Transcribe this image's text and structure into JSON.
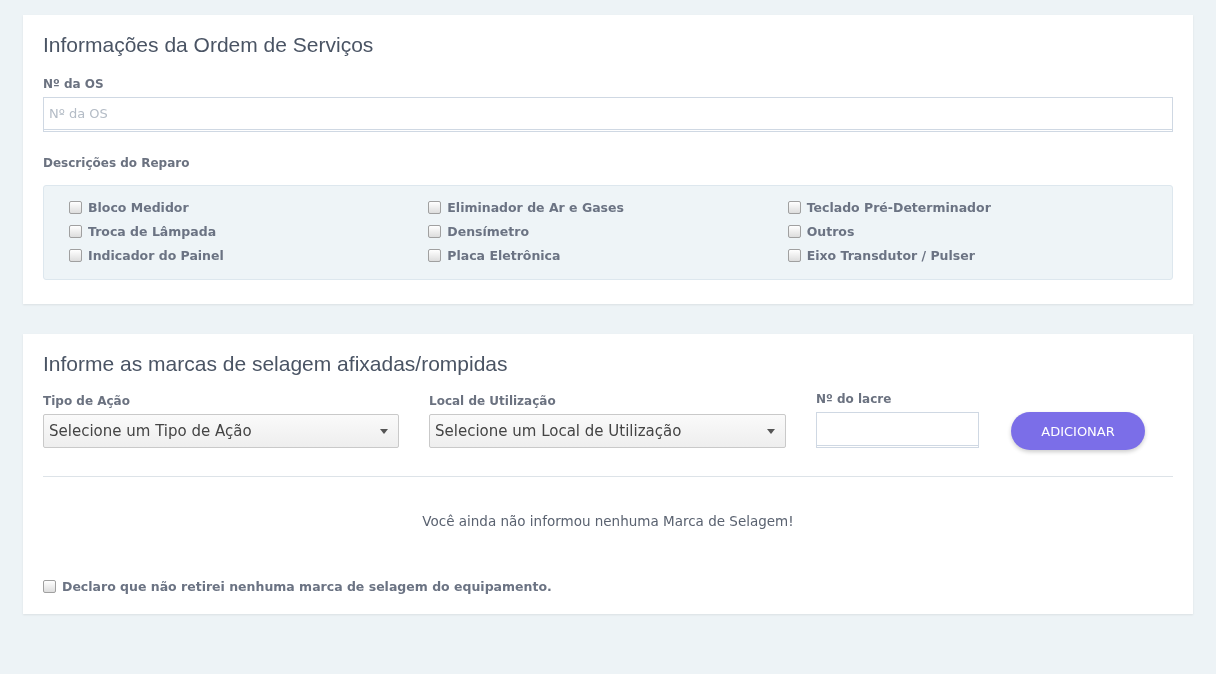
{
  "service_order": {
    "title": "Informações da Ordem de Serviços",
    "os_field": {
      "label": "Nº da OS",
      "placeholder": "Nº da OS"
    },
    "repairs": {
      "label": "Descrições do Reparo",
      "items": [
        {
          "label": "Bloco Medidor",
          "checked": false
        },
        {
          "label": "Eliminador de Ar e Gases",
          "checked": false
        },
        {
          "label": "Teclado Pré-Determinador",
          "checked": false
        },
        {
          "label": "Troca de Lâmpada",
          "checked": false
        },
        {
          "label": "Densímetro",
          "checked": false
        },
        {
          "label": "Outros",
          "checked": false
        },
        {
          "label": "Indicador do Painel",
          "checked": false
        },
        {
          "label": "Placa Eletrônica",
          "checked": false
        },
        {
          "label": "Eixo Transdutor / Pulser",
          "checked": false
        }
      ]
    }
  },
  "seals": {
    "title": "Informe as marcas de selagem afixadas/rompidas",
    "action_type": {
      "label": "Tipo de Ação",
      "value": "Selecione um Tipo de Ação"
    },
    "usage_location": {
      "label": "Local de Utilização",
      "value": "Selecione um Local de Utilização"
    },
    "seal_number": {
      "label": "Nº do lacre"
    },
    "add_button": "ADICIONAR",
    "empty_message": "Você ainda não informou nenhuma Marca de Selagem!",
    "declaration": {
      "label": "Declaro que não retirei nenhuma marca de selagem do equipamento.",
      "checked": false
    }
  }
}
